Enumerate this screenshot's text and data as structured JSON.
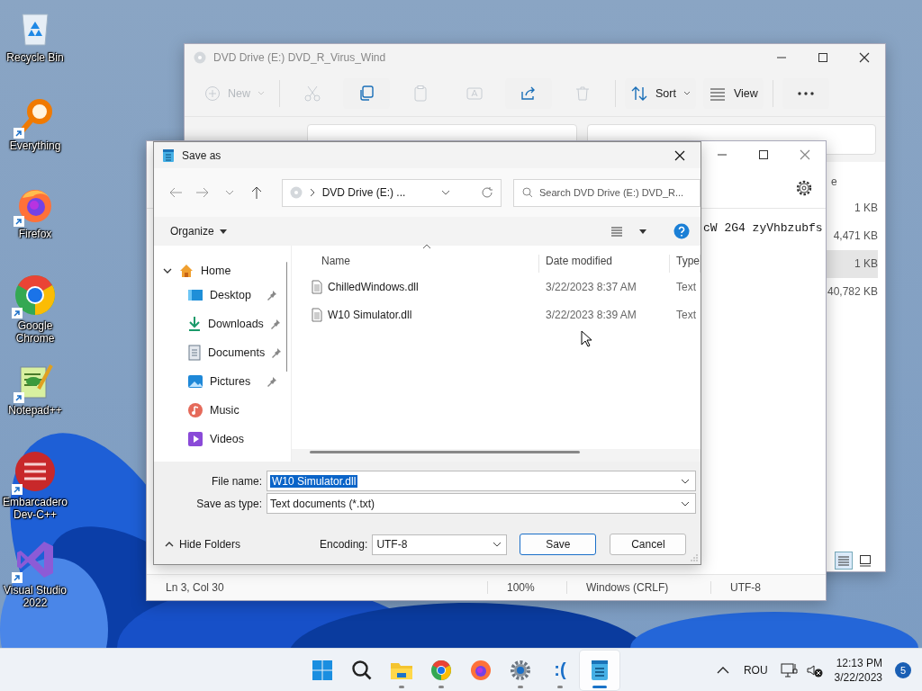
{
  "desktop_icons": [
    {
      "kind": "recycle-bin",
      "label": "Recycle Bin",
      "shortcut": false
    },
    {
      "kind": "everything",
      "label": "Everything",
      "shortcut": true
    },
    {
      "kind": "firefox",
      "label": "Firefox",
      "shortcut": true
    },
    {
      "kind": "chrome",
      "label": "Google Chrome",
      "shortcut": true
    },
    {
      "kind": "notepadpp",
      "label": "Notepad++",
      "shortcut": true
    },
    {
      "kind": "devcpp",
      "label": "Embarcadero Dev-C++",
      "shortcut": true
    },
    {
      "kind": "vs",
      "label": "Visual Studio 2022",
      "shortcut": true
    }
  ],
  "explorer": {
    "title": "DVD Drive (E:) DVD_R_Virus_Wind",
    "toolbar": [
      {
        "kind": "new",
        "label": "New",
        "disabled": true
      },
      {
        "kind": "cut",
        "disabled": true
      },
      {
        "kind": "copy",
        "disabled": false
      },
      {
        "kind": "paste",
        "disabled": true
      },
      {
        "kind": "rename",
        "disabled": true
      },
      {
        "kind": "share",
        "disabled": false
      },
      {
        "kind": "delete",
        "disabled": true
      },
      {
        "kind": "sort",
        "label": "Sort",
        "disabled": false
      },
      {
        "kind": "view",
        "label": "View",
        "disabled": false
      },
      {
        "kind": "more",
        "disabled": false
      }
    ],
    "size_header": "e",
    "sizes": [
      {
        "text": "1 KB",
        "selected": false
      },
      {
        "text": "4,471 KB",
        "selected": false
      },
      {
        "text": "1 KB",
        "selected": true
      },
      {
        "text": "40,782 KB",
        "selected": false
      }
    ]
  },
  "notepad": {
    "line": "cW 2G4 zyVhbzubfs",
    "status": [
      "Ln 3, Col 30",
      "100%",
      "Windows (CRLF)",
      "UTF-8"
    ]
  },
  "dialog": {
    "title": "Save as",
    "address": "DVD Drive (E:) ...",
    "search_placeholder": "Search DVD Drive (E:) DVD_R...",
    "organize": "Organize",
    "tree": [
      {
        "kind": "home",
        "label": "Home",
        "expanded": true,
        "children": [
          {
            "kind": "desktop",
            "label": "Desktop",
            "pinned": true
          },
          {
            "kind": "downloads",
            "label": "Downloads",
            "pinned": true
          },
          {
            "kind": "documents",
            "label": "Documents",
            "pinned": true
          },
          {
            "kind": "pictures",
            "label": "Pictures",
            "pinned": true
          },
          {
            "kind": "music",
            "label": "Music",
            "pinned": false
          },
          {
            "kind": "videos",
            "label": "Videos",
            "pinned": false
          }
        ]
      }
    ],
    "columns": [
      "Name",
      "Date modified",
      "Type"
    ],
    "files": [
      {
        "name": "ChilledWindows.dll",
        "date": "3/22/2023 8:37 AM",
        "type": "Text"
      },
      {
        "name": "W10 Simulator.dll",
        "date": "3/22/2023 8:39 AM",
        "type": "Text"
      }
    ],
    "file_name_label": "File name:",
    "file_name": {
      "value": "W10 Simulator.dll",
      "selected": true
    },
    "type_label": "Save as type:",
    "type_value": "Text documents (*.txt)",
    "hide_folders": "Hide Folders",
    "encoding_label": "Encoding:",
    "encoding": "UTF-8",
    "buttons": [
      {
        "label": "Save",
        "default": true
      },
      {
        "label": "Cancel",
        "default": false
      }
    ]
  },
  "taskbar": {
    "apps": [
      {
        "kind": "start",
        "running": false,
        "active": false
      },
      {
        "kind": "search",
        "running": false,
        "active": false
      },
      {
        "kind": "explorer",
        "running": true,
        "active": false
      },
      {
        "kind": "chrome",
        "running": true,
        "active": false
      },
      {
        "kind": "firefox",
        "running": false,
        "active": false
      },
      {
        "kind": "settings",
        "running": true,
        "active": false
      },
      {
        "kind": "text",
        "label": ":(",
        "running": true,
        "active": false
      },
      {
        "kind": "notepad",
        "running": true,
        "active": true
      }
    ],
    "language": "ROU",
    "time": "12:13 PM",
    "date": "3/22/2023",
    "notifications": "5"
  }
}
